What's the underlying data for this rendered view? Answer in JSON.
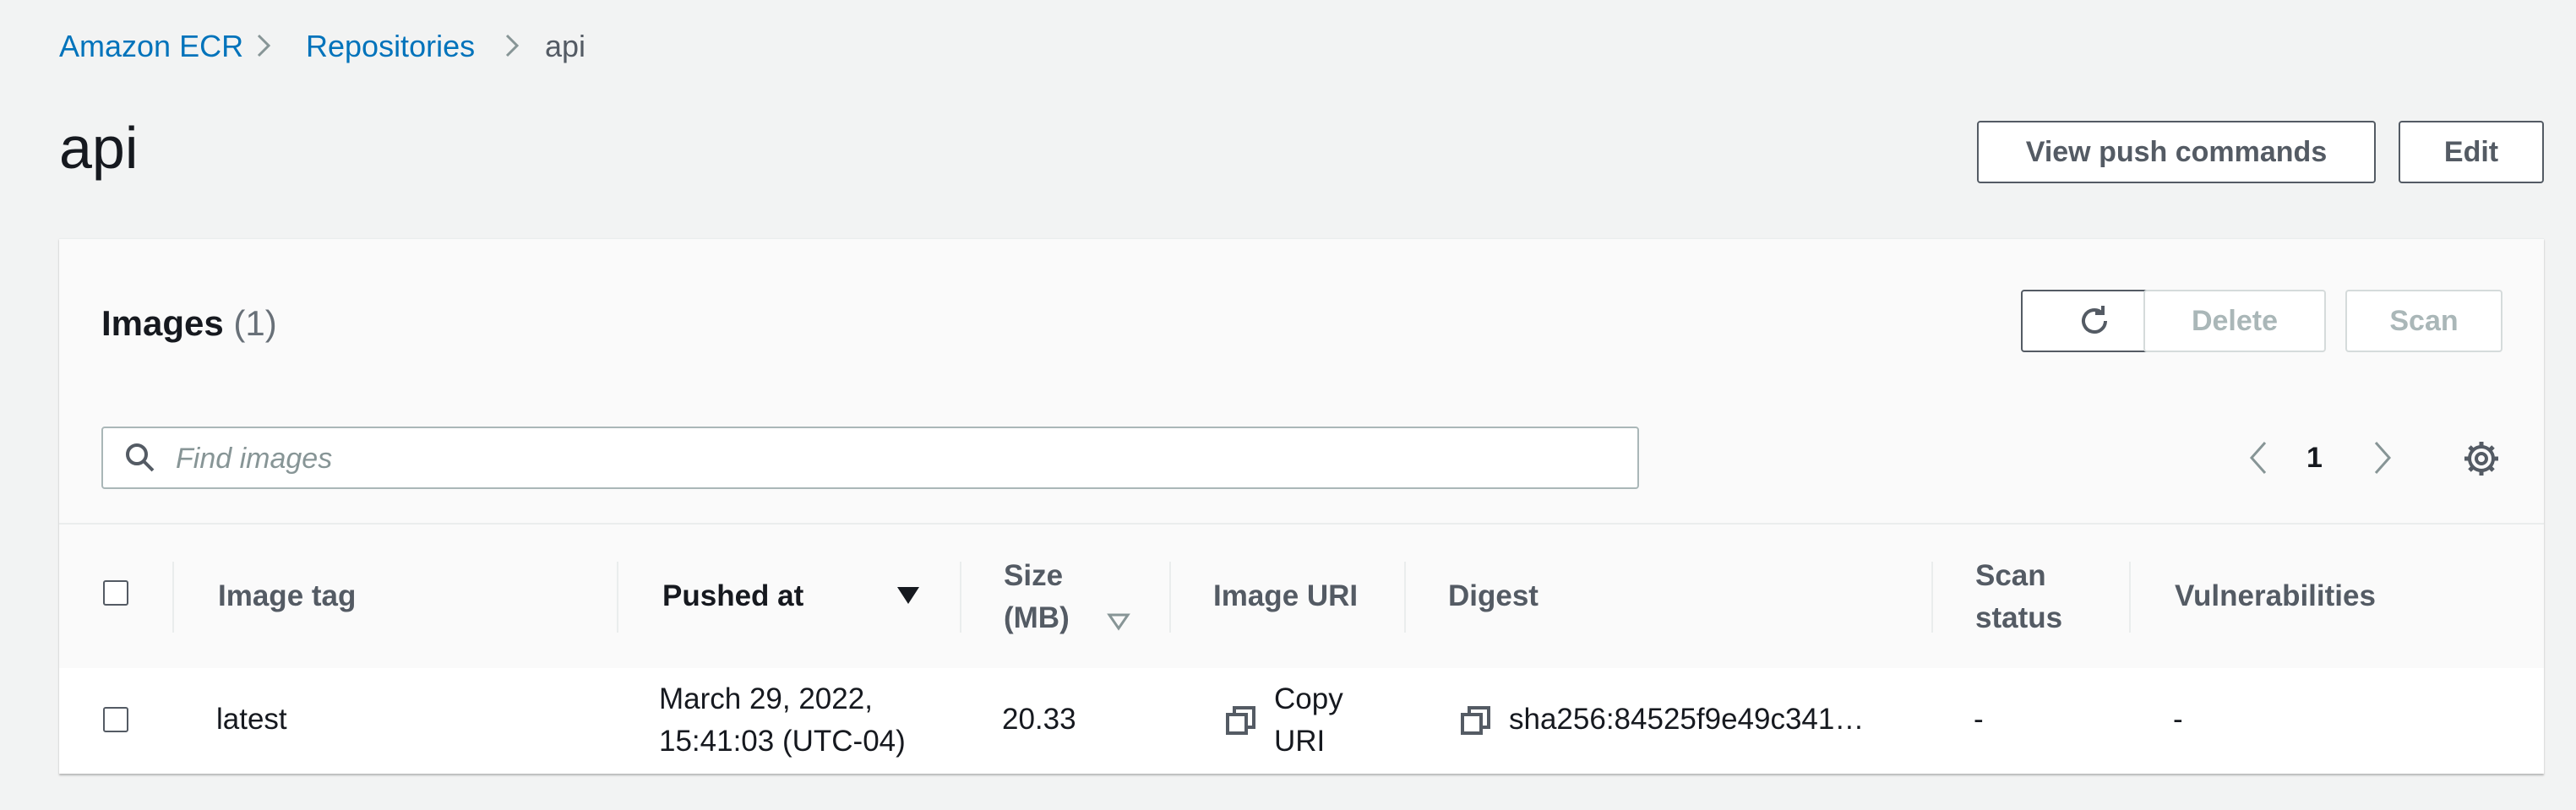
{
  "breadcrumb": {
    "items": [
      {
        "label": "Amazon ECR"
      },
      {
        "label": "Repositories"
      },
      {
        "label": "api"
      }
    ]
  },
  "page": {
    "title": "api",
    "view_push_commands_label": "View push commands",
    "edit_label": "Edit"
  },
  "images_panel": {
    "title": "Images",
    "count": "(1)",
    "delete_label": "Delete",
    "scan_label": "Scan",
    "search_placeholder": "Find images",
    "page_number": "1"
  },
  "table": {
    "columns": {
      "image_tag": "Image tag",
      "pushed_at": "Pushed at",
      "size_line1": "Size",
      "size_line2": "(MB)",
      "image_uri": "Image URI",
      "digest": "Digest",
      "scan_status_line1": "Scan",
      "scan_status_line2": "status",
      "vulnerabilities": "Vulnerabilities"
    },
    "rows": [
      {
        "image_tag": "latest",
        "pushed_at_line1": "March 29, 2022,",
        "pushed_at_line2": "15:41:03 (UTC-04)",
        "size": "20.33",
        "copy_uri_line1": "Copy",
        "copy_uri_line2": "URI",
        "digest": "sha256:84525f9e49c341…",
        "scan_status": "-",
        "vulnerabilities": "-"
      }
    ]
  },
  "colors": {
    "link": "#0073bb",
    "background": "#f2f3f3",
    "panel": "#fafafa",
    "text": "#16191f",
    "secondary_text": "#545b64",
    "disabled": "#aab7b8"
  }
}
